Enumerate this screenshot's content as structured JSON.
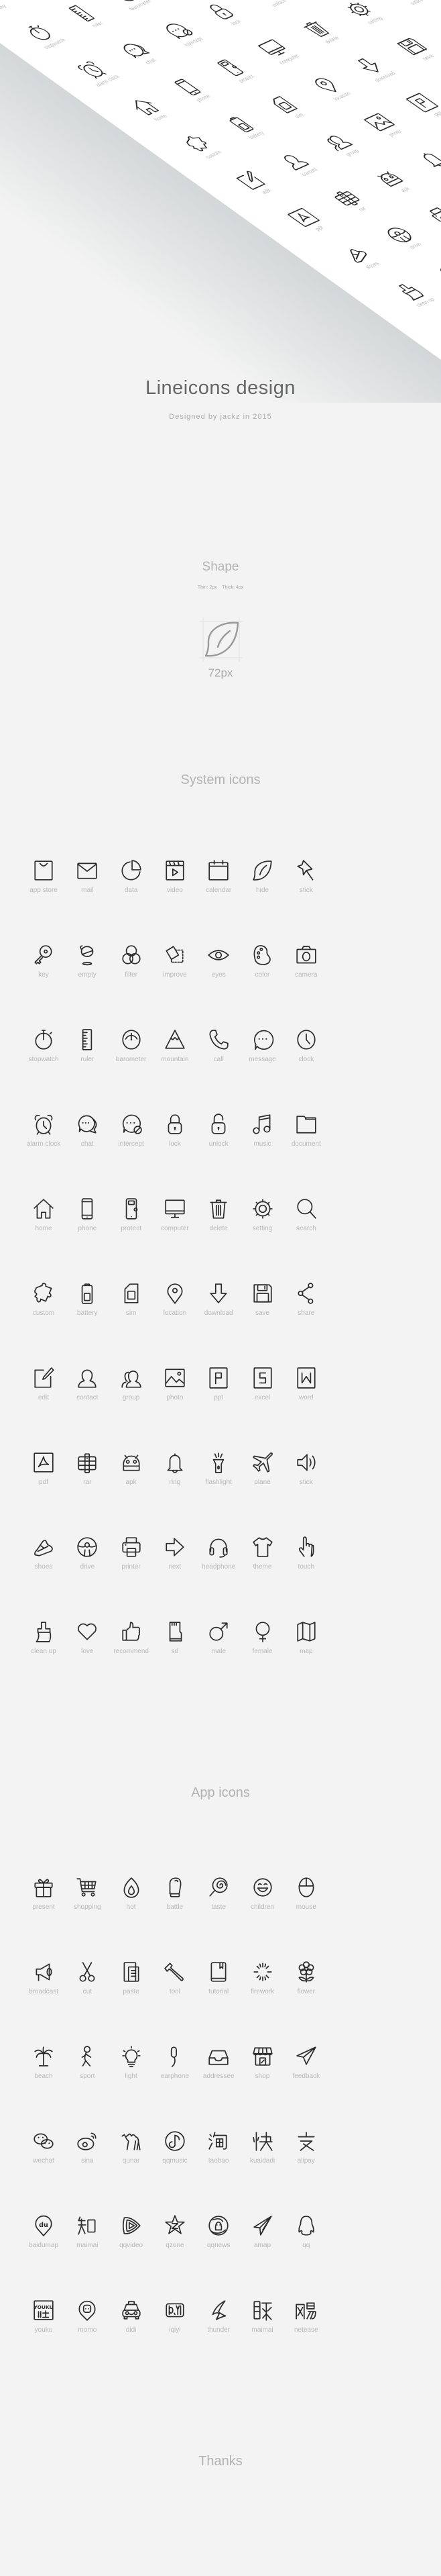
{
  "header": {
    "title": "Lineicons design",
    "subtitle": "Designed by jackz in 2015"
  },
  "shape": {
    "title": "Shape",
    "stroke_spec": "Thin: 2px    Thick: 4px",
    "sample_icon": "leaf-icon",
    "size_label": "72px"
  },
  "system": {
    "title": "System icons",
    "icons": [
      {
        "label": "app store",
        "icon": "appstore"
      },
      {
        "label": "mail",
        "icon": "mail"
      },
      {
        "label": "data",
        "icon": "data"
      },
      {
        "label": "video",
        "icon": "video"
      },
      {
        "label": "calendar",
        "icon": "calendar"
      },
      {
        "label": "hide",
        "icon": "leaf"
      },
      {
        "label": "stick",
        "icon": "pin"
      },
      {
        "label": "key",
        "icon": "key"
      },
      {
        "label": "empty",
        "icon": "empty"
      },
      {
        "label": "filter",
        "icon": "filter"
      },
      {
        "label": "improve",
        "icon": "improve"
      },
      {
        "label": "eyes",
        "icon": "eye"
      },
      {
        "label": "color",
        "icon": "palette"
      },
      {
        "label": "camera",
        "icon": "camera"
      },
      {
        "label": "stopwatch",
        "icon": "stopwatch"
      },
      {
        "label": "ruler",
        "icon": "ruler"
      },
      {
        "label": "barometer",
        "icon": "barometer"
      },
      {
        "label": "mountain",
        "icon": "mountain"
      },
      {
        "label": "call",
        "icon": "call"
      },
      {
        "label": "message",
        "icon": "message"
      },
      {
        "label": "clock",
        "icon": "clock"
      },
      {
        "label": "alarm clock",
        "icon": "alarm"
      },
      {
        "label": "chat",
        "icon": "chat"
      },
      {
        "label": "intercept",
        "icon": "intercept"
      },
      {
        "label": "lock",
        "icon": "lock"
      },
      {
        "label": "unlock",
        "icon": "unlock"
      },
      {
        "label": "music",
        "icon": "music"
      },
      {
        "label": "document",
        "icon": "folder"
      },
      {
        "label": "home",
        "icon": "home"
      },
      {
        "label": "phone",
        "icon": "phone"
      },
      {
        "label": "protect",
        "icon": "protect"
      },
      {
        "label": "computer",
        "icon": "computer"
      },
      {
        "label": "delete",
        "icon": "trash"
      },
      {
        "label": "setting",
        "icon": "gear"
      },
      {
        "label": "search",
        "icon": "search"
      },
      {
        "label": "custom",
        "icon": "puzzle"
      },
      {
        "label": "battery",
        "icon": "battery"
      },
      {
        "label": "sim",
        "icon": "sim"
      },
      {
        "label": "location",
        "icon": "location"
      },
      {
        "label": "download",
        "icon": "download"
      },
      {
        "label": "save",
        "icon": "save"
      },
      {
        "label": "share",
        "icon": "share"
      },
      {
        "label": "edit",
        "icon": "edit"
      },
      {
        "label": "contact",
        "icon": "contact"
      },
      {
        "label": "group",
        "icon": "group"
      },
      {
        "label": "photo",
        "icon": "photo"
      },
      {
        "label": "ppt",
        "icon": "ppt"
      },
      {
        "label": "excel",
        "icon": "excel"
      },
      {
        "label": "word",
        "icon": "word"
      },
      {
        "label": "pdf",
        "icon": "pdf"
      },
      {
        "label": "rar",
        "icon": "rar"
      },
      {
        "label": "apk",
        "icon": "android"
      },
      {
        "label": "ring",
        "icon": "bell"
      },
      {
        "label": "flashlight",
        "icon": "flashlight"
      },
      {
        "label": "plane",
        "icon": "plane"
      },
      {
        "label": "stick",
        "icon": "volume"
      },
      {
        "label": "shoes",
        "icon": "shoe"
      },
      {
        "label": "drive",
        "icon": "wheel"
      },
      {
        "label": "printer",
        "icon": "printer"
      },
      {
        "label": "next",
        "icon": "next"
      },
      {
        "label": "headphone",
        "icon": "headphone"
      },
      {
        "label": "theme",
        "icon": "shirt"
      },
      {
        "label": "touch",
        "icon": "hand"
      },
      {
        "label": "clean up",
        "icon": "brush"
      },
      {
        "label": "love",
        "icon": "heart"
      },
      {
        "label": "recommend",
        "icon": "thumb"
      },
      {
        "label": "sd",
        "icon": "sd"
      },
      {
        "label": "male",
        "icon": "male"
      },
      {
        "label": "female",
        "icon": "female"
      },
      {
        "label": "map",
        "icon": "map"
      }
    ]
  },
  "app": {
    "title": "App icons",
    "icons": [
      {
        "label": "present",
        "icon": "gift"
      },
      {
        "label": "shopping",
        "icon": "cart"
      },
      {
        "label": "hot",
        "icon": "fire"
      },
      {
        "label": "battle",
        "icon": "glove"
      },
      {
        "label": "taste",
        "icon": "lollipop"
      },
      {
        "label": "children",
        "icon": "child"
      },
      {
        "label": "mouse",
        "icon": "mouse"
      },
      {
        "label": "broadcast",
        "icon": "megaphone"
      },
      {
        "label": "cut",
        "icon": "scissors"
      },
      {
        "label": "paste",
        "icon": "paste"
      },
      {
        "label": "tool",
        "icon": "wrench"
      },
      {
        "label": "tutorial",
        "icon": "book"
      },
      {
        "label": "firework",
        "icon": "firework"
      },
      {
        "label": "flower",
        "icon": "flower"
      },
      {
        "label": "beach",
        "icon": "palm"
      },
      {
        "label": "sport",
        "icon": "runner"
      },
      {
        "label": "light",
        "icon": "bulb"
      },
      {
        "label": "earphone",
        "icon": "earphone"
      },
      {
        "label": "addressee",
        "icon": "inbox"
      },
      {
        "label": "shop",
        "icon": "store"
      },
      {
        "label": "feedback",
        "icon": "paperplane"
      },
      {
        "label": "wechat",
        "icon": "wechat"
      },
      {
        "label": "sina",
        "icon": "weibo"
      },
      {
        "label": "qunar",
        "icon": "camel"
      },
      {
        "label": "qqmusic",
        "icon": "qqmusic"
      },
      {
        "label": "taobao",
        "icon": "taobao"
      },
      {
        "label": "kuaidadi",
        "icon": "kuai"
      },
      {
        "label": "alipay",
        "icon": "alipay"
      },
      {
        "label": "baidumap",
        "icon": "baidumap"
      },
      {
        "label": "maimai",
        "icon": "zhi"
      },
      {
        "label": "qqvideo",
        "icon": "qqvideo"
      },
      {
        "label": "qzone",
        "icon": "qzone"
      },
      {
        "label": "qqnews",
        "icon": "qqnews"
      },
      {
        "label": "amap",
        "icon": "amap"
      },
      {
        "label": "qq",
        "icon": "penguin"
      },
      {
        "label": "youku",
        "icon": "youku"
      },
      {
        "label": "momo",
        "icon": "momo"
      },
      {
        "label": "didi",
        "icon": "taxi"
      },
      {
        "label": "iqiyi",
        "icon": "iqiyi"
      },
      {
        "label": "thunder",
        "icon": "thunder"
      },
      {
        "label": "maimai",
        "icon": "mai"
      },
      {
        "label": "netease",
        "icon": "netease"
      }
    ],
    "logo_lettering": {
      "baidumap": "du",
      "youku": "YOUKU 优酷",
      "iqiyi": "iQIYI",
      "netease": "網易"
    }
  },
  "footer": {
    "text": "Thanks"
  },
  "colors": {
    "background": "#f3f3f3",
    "icon_stroke": "#2b2b2b",
    "label": "#b8b8b8",
    "title": "#666666",
    "hero_card": "#ffffff",
    "hero_shadow": "#d3d7d8"
  }
}
